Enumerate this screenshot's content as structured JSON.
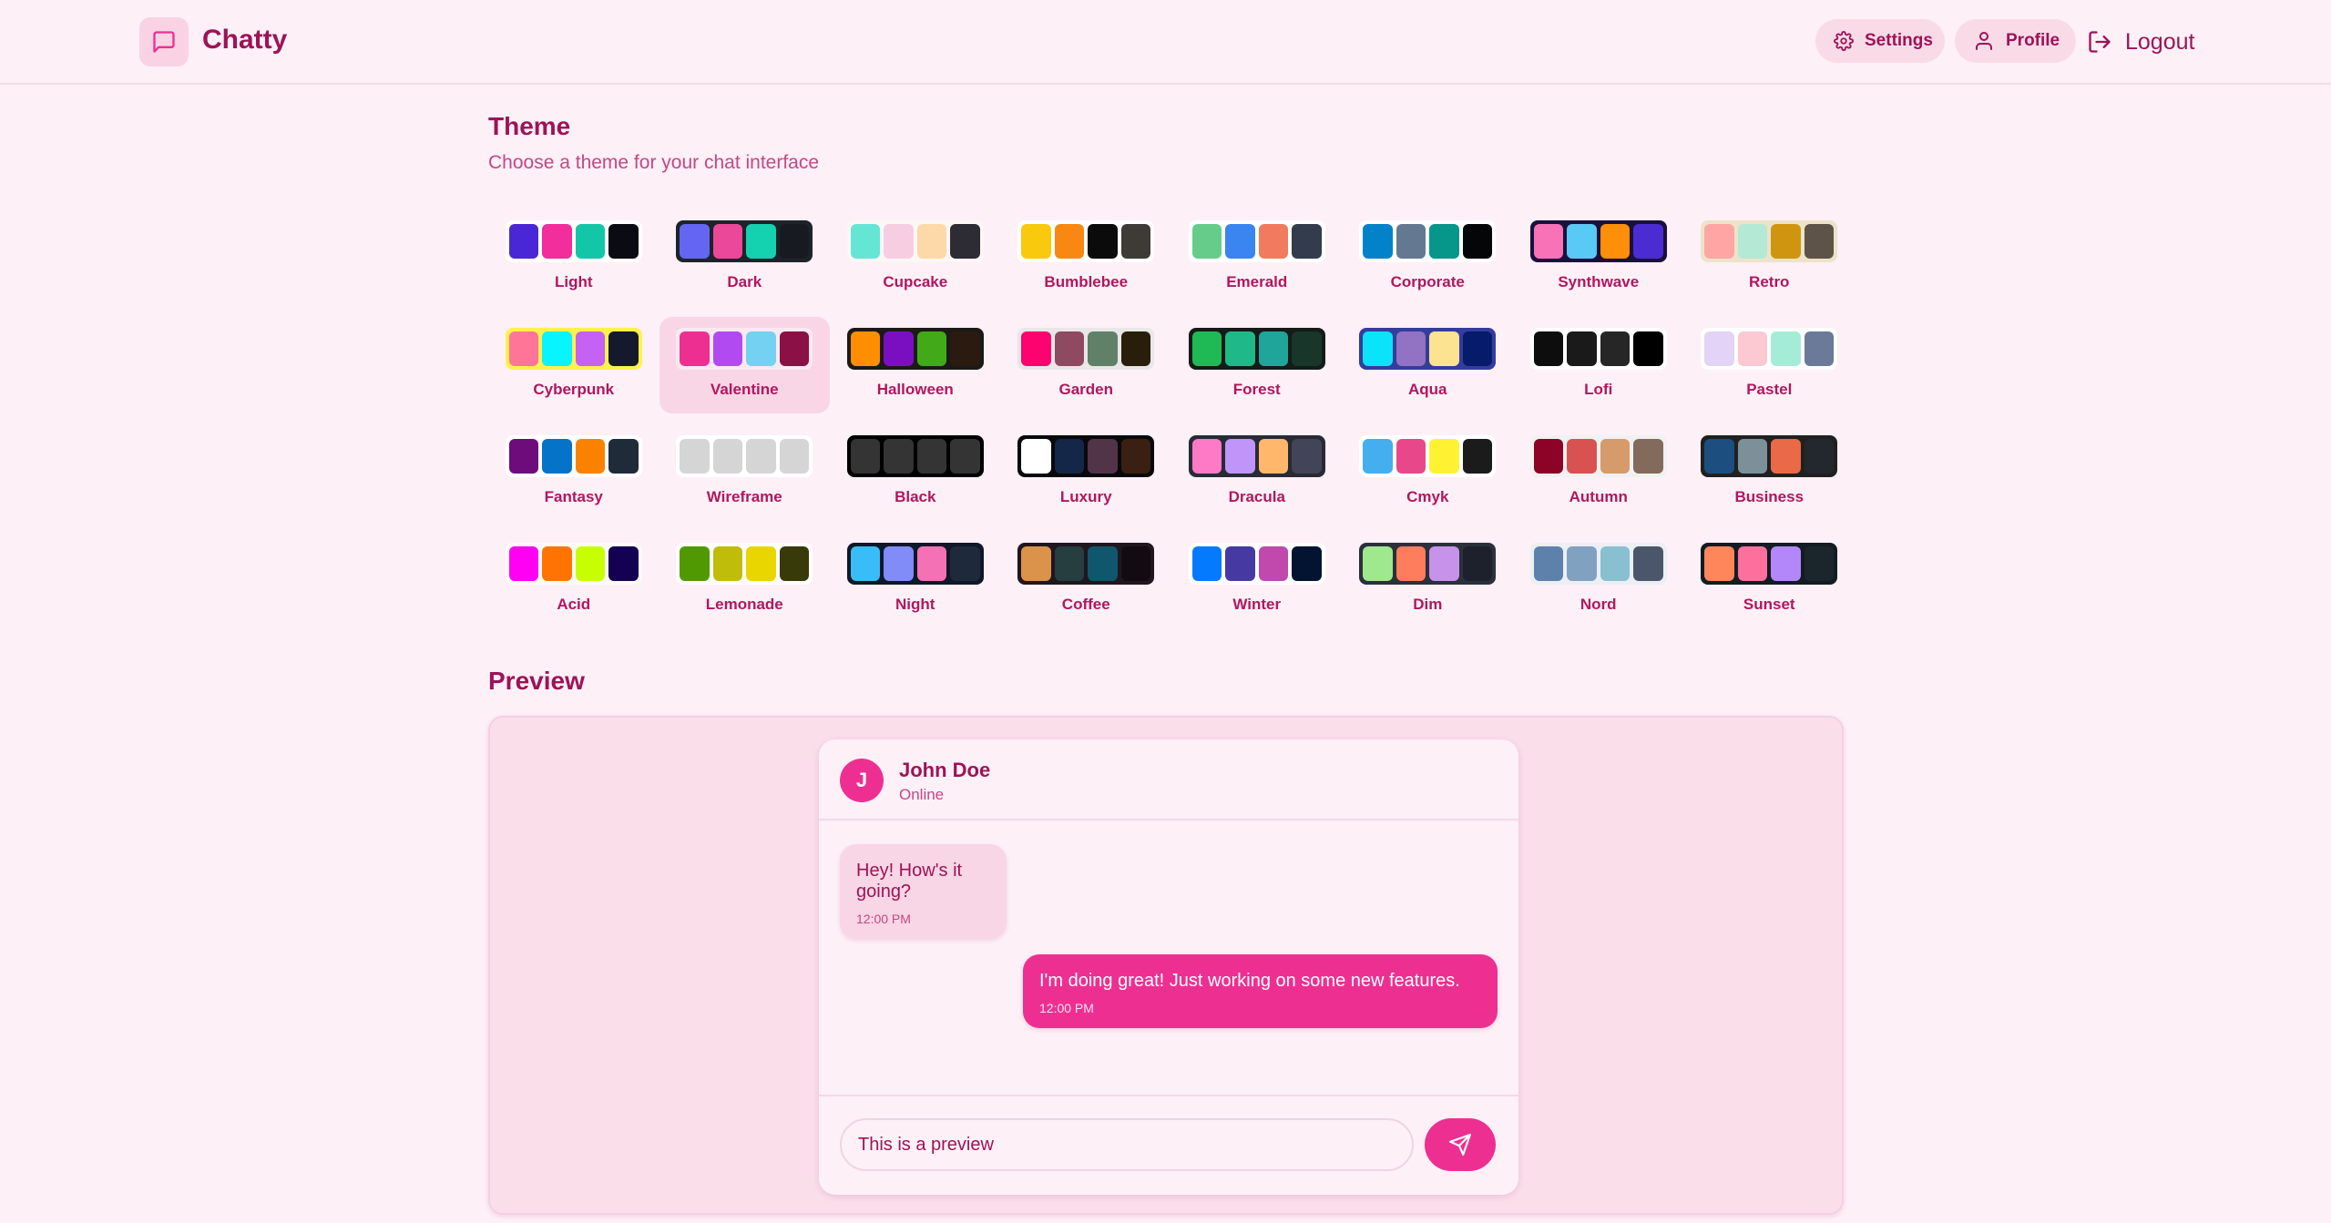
{
  "app": {
    "name": "Chatty"
  },
  "nav": {
    "settings_label": "Settings",
    "profile_label": "Profile",
    "logout_label": "Logout"
  },
  "theme": {
    "title": "Theme",
    "subtitle": "Choose a theme for your chat interface",
    "selected": "Valentine",
    "items": [
      {
        "label": "Light",
        "bg": "#ffffff",
        "colors": [
          "#4a27d6",
          "#f22d9c",
          "#14c6a8",
          "#0b0b14"
        ]
      },
      {
        "label": "Dark",
        "bg": "#1d232a",
        "colors": [
          "#6466f1",
          "#ec4899",
          "#14d1b0",
          "#171b21"
        ]
      },
      {
        "label": "Cupcake",
        "bg": "#faf7f5",
        "colors": [
          "#65e6d5",
          "#f7cde1",
          "#fdd9a9",
          "#2d2b33"
        ]
      },
      {
        "label": "Bumblebee",
        "bg": "#ffffff",
        "colors": [
          "#f9c90d",
          "#f88811",
          "#0b0b0c",
          "#3e3a35"
        ]
      },
      {
        "label": "Emerald",
        "bg": "#ffffff",
        "colors": [
          "#66cc8a",
          "#3a85f0",
          "#f07b5e",
          "#333c4d"
        ]
      },
      {
        "label": "Corporate",
        "bg": "#ffffff",
        "colors": [
          "#0283c9",
          "#657891",
          "#06968a",
          "#050607"
        ]
      },
      {
        "label": "Synthwave",
        "bg": "#1a103d",
        "colors": [
          "#f872b8",
          "#59c9f6",
          "#ff8e08",
          "#4a2cd2"
        ]
      },
      {
        "label": "Retro",
        "bg": "#ece3ca",
        "colors": [
          "#ffa5a3",
          "#b4e9d6",
          "#d09510",
          "#5e5349"
        ]
      },
      {
        "label": "Cyberpunk",
        "bg": "#fef24d",
        "colors": [
          "#ff7598",
          "#08f4ff",
          "#c561f3",
          "#14192e"
        ]
      },
      {
        "label": "Valentine",
        "bg": "#fbe9f2",
        "colors": [
          "#ee2f92",
          "#b14af1",
          "#75d1f0",
          "#8a1045"
        ]
      },
      {
        "label": "Halloween",
        "bg": "#1c1a17",
        "colors": [
          "#ff8f00",
          "#7a0fc2",
          "#42aa19",
          "#2a1a10"
        ]
      },
      {
        "label": "Garden",
        "bg": "#e9e7e7",
        "colors": [
          "#fc036f",
          "#8e4a60",
          "#608167",
          "#281e0a"
        ]
      },
      {
        "label": "Forest",
        "bg": "#161a18",
        "colors": [
          "#1fb956",
          "#1fb988",
          "#1fa59a",
          "#19362b"
        ]
      },
      {
        "label": "Aqua",
        "bg": "#343c9d",
        "colors": [
          "#0ae3f9",
          "#9272c2",
          "#fce391",
          "#061b6a"
        ]
      },
      {
        "label": "Lofi",
        "bg": "#ffffff",
        "colors": [
          "#0d0d0d",
          "#1a1a1a",
          "#262626",
          "#000000"
        ]
      },
      {
        "label": "Pastel",
        "bg": "#ffffff",
        "colors": [
          "#e3d3f6",
          "#fcc8d2",
          "#a5ecd6",
          "#6b7a98"
        ]
      },
      {
        "label": "Fantasy",
        "bg": "#ffffff",
        "colors": [
          "#6e0c7c",
          "#0473c8",
          "#fb8200",
          "#202b3a"
        ]
      },
      {
        "label": "Wireframe",
        "bg": "#ffffff",
        "colors": [
          "#d5d5d5",
          "#d5d5d5",
          "#d5d5d5",
          "#d5d5d5"
        ]
      },
      {
        "label": "Black",
        "bg": "#000000",
        "colors": [
          "#343434",
          "#343434",
          "#343434",
          "#343434"
        ]
      },
      {
        "label": "Luxury",
        "bg": "#09090b",
        "colors": [
          "#ffffff",
          "#152748",
          "#513448",
          "#3a2012"
        ]
      },
      {
        "label": "Dracula",
        "bg": "#282a36",
        "colors": [
          "#ff7ac6",
          "#bf95f9",
          "#ffb86b",
          "#414557"
        ]
      },
      {
        "label": "Cmyk",
        "bg": "#ffffff",
        "colors": [
          "#45aeee",
          "#e8488a",
          "#fff232",
          "#1b1b1b"
        ]
      },
      {
        "label": "Autumn",
        "bg": "#f1f1f1",
        "colors": [
          "#8c0327",
          "#d85251",
          "#d59b6a",
          "#826a5c"
        ]
      },
      {
        "label": "Business",
        "bg": "#202020",
        "colors": [
          "#1c4e80",
          "#7c909a",
          "#ea6947",
          "#23282e"
        ]
      },
      {
        "label": "Acid",
        "bg": "#fafafa",
        "colors": [
          "#ff00f4",
          "#ff7400",
          "#c8ff00",
          "#140152"
        ]
      },
      {
        "label": "Lemonade",
        "bg": "#ffffff",
        "colors": [
          "#519903",
          "#bfbd09",
          "#e9d600",
          "#393a0a"
        ]
      },
      {
        "label": "Night",
        "bg": "#0f1729",
        "colors": [
          "#38bdf8",
          "#818cf8",
          "#f471b5",
          "#1e293b"
        ]
      },
      {
        "label": "Coffee",
        "bg": "#20161f",
        "colors": [
          "#db924b",
          "#263e3f",
          "#10576d",
          "#120c12"
        ]
      },
      {
        "label": "Winter",
        "bg": "#ffffff",
        "colors": [
          "#047aff",
          "#463aa2",
          "#c148ac",
          "#021431"
        ]
      },
      {
        "label": "Dim",
        "bg": "#2a303c",
        "colors": [
          "#9fe88d",
          "#ff7d5c",
          "#c792e9",
          "#1c212b"
        ]
      },
      {
        "label": "Nord",
        "bg": "#eceff4",
        "colors": [
          "#5e81ac",
          "#81a1c1",
          "#88c0d0",
          "#4c566a"
        ]
      },
      {
        "label": "Sunset",
        "bg": "#121c22",
        "colors": [
          "#ff865b",
          "#fd6f9c",
          "#b387fa",
          "#1b262c"
        ]
      }
    ]
  },
  "preview": {
    "title": "Preview",
    "contact": {
      "initial": "J",
      "name": "John Doe",
      "status": "Online"
    },
    "messages": [
      {
        "text": "Hey! How's it going?",
        "time": "12:00 PM",
        "sent": false
      },
      {
        "text": "I'm doing great! Just working on some new features.",
        "time": "12:00 PM",
        "sent": true
      }
    ],
    "input_value": "This is a preview"
  },
  "colors": {
    "primary": "#ee2f92",
    "text": "#9d1357",
    "background": "#fdf0f6"
  }
}
